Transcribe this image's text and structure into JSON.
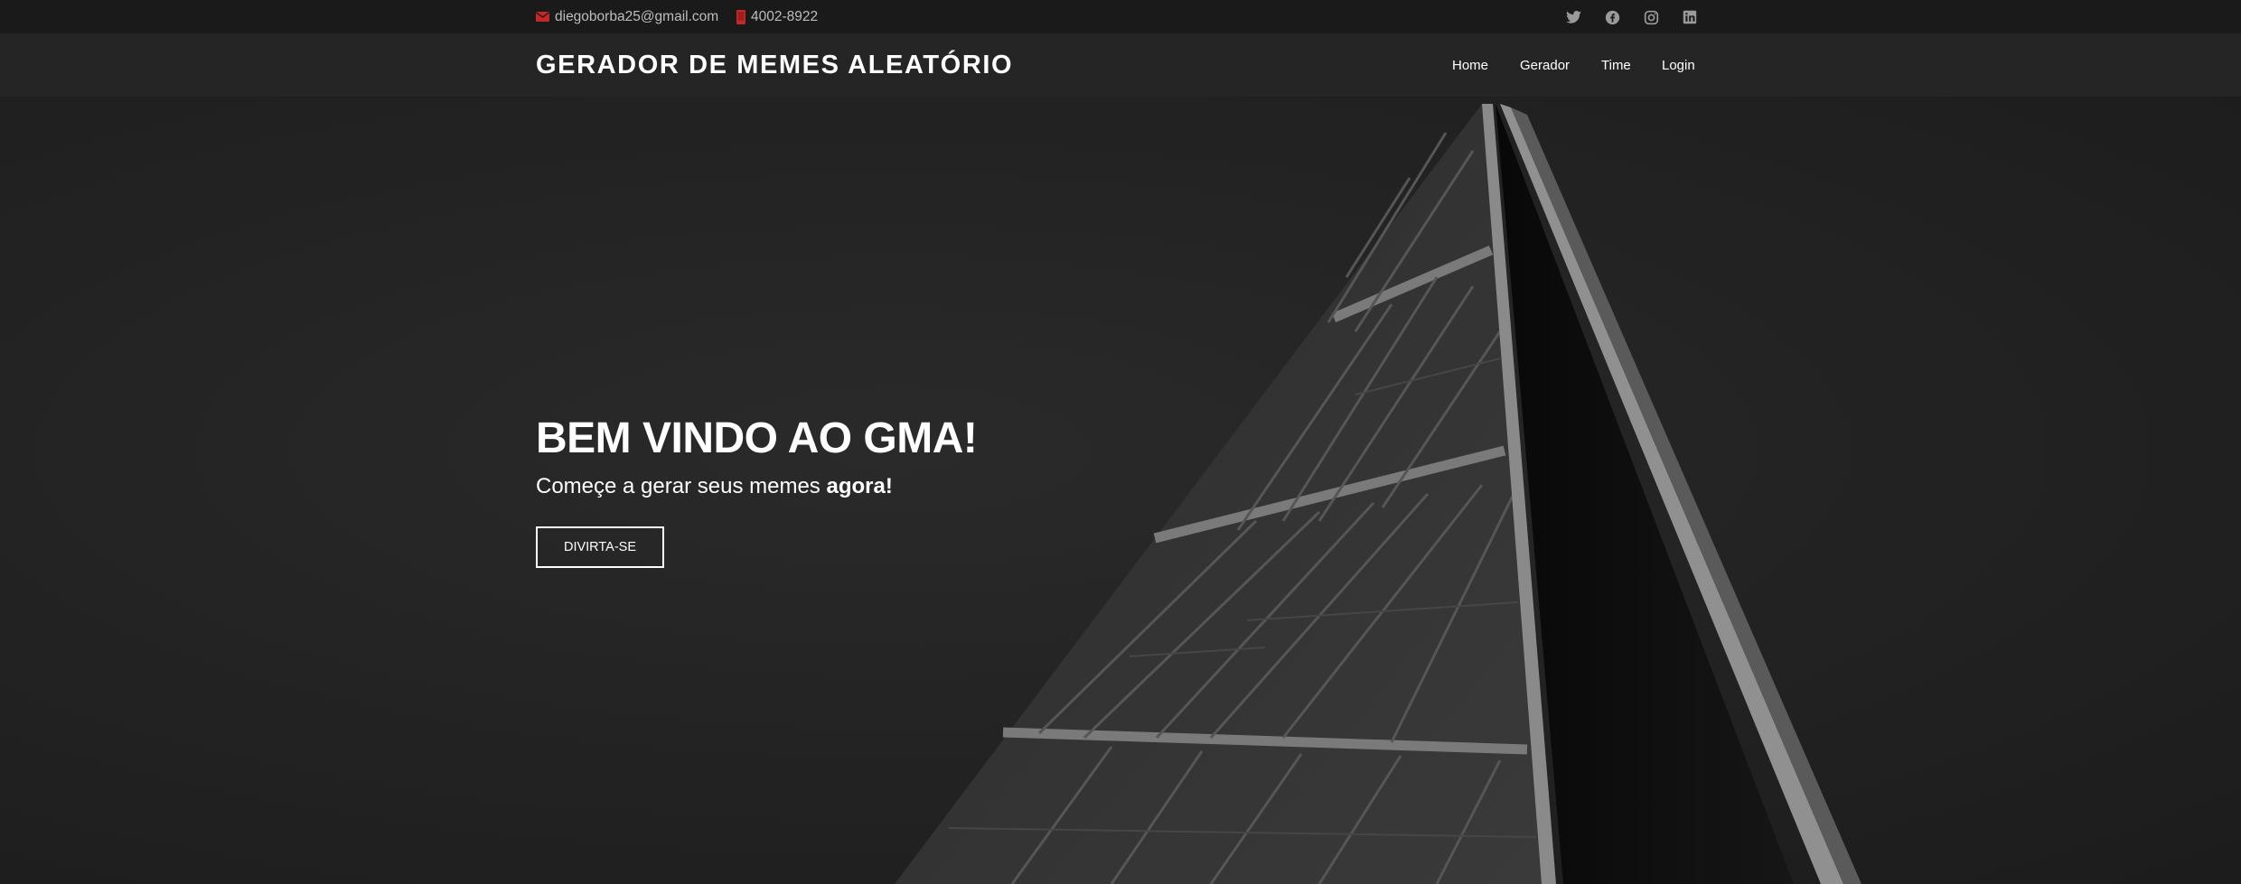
{
  "topbar": {
    "email": "diegoborba25@gmail.com",
    "phone": "4002-8922",
    "accent_color": "#c62828",
    "social_icons": [
      "twitter-icon",
      "facebook-icon",
      "instagram-icon",
      "linkedin-icon"
    ]
  },
  "header": {
    "brand": "GERADOR DE MEMES ALEATÓRIO",
    "nav": {
      "home": "Home",
      "gerador": "Gerador",
      "time": "Time",
      "login": "Login"
    }
  },
  "hero": {
    "title": "BEM VINDO AO GMA!",
    "subtitle_prefix": "Começe a gerar seus memes ",
    "subtitle_bold": "agora!",
    "button": "DIVIRTA-SE"
  }
}
